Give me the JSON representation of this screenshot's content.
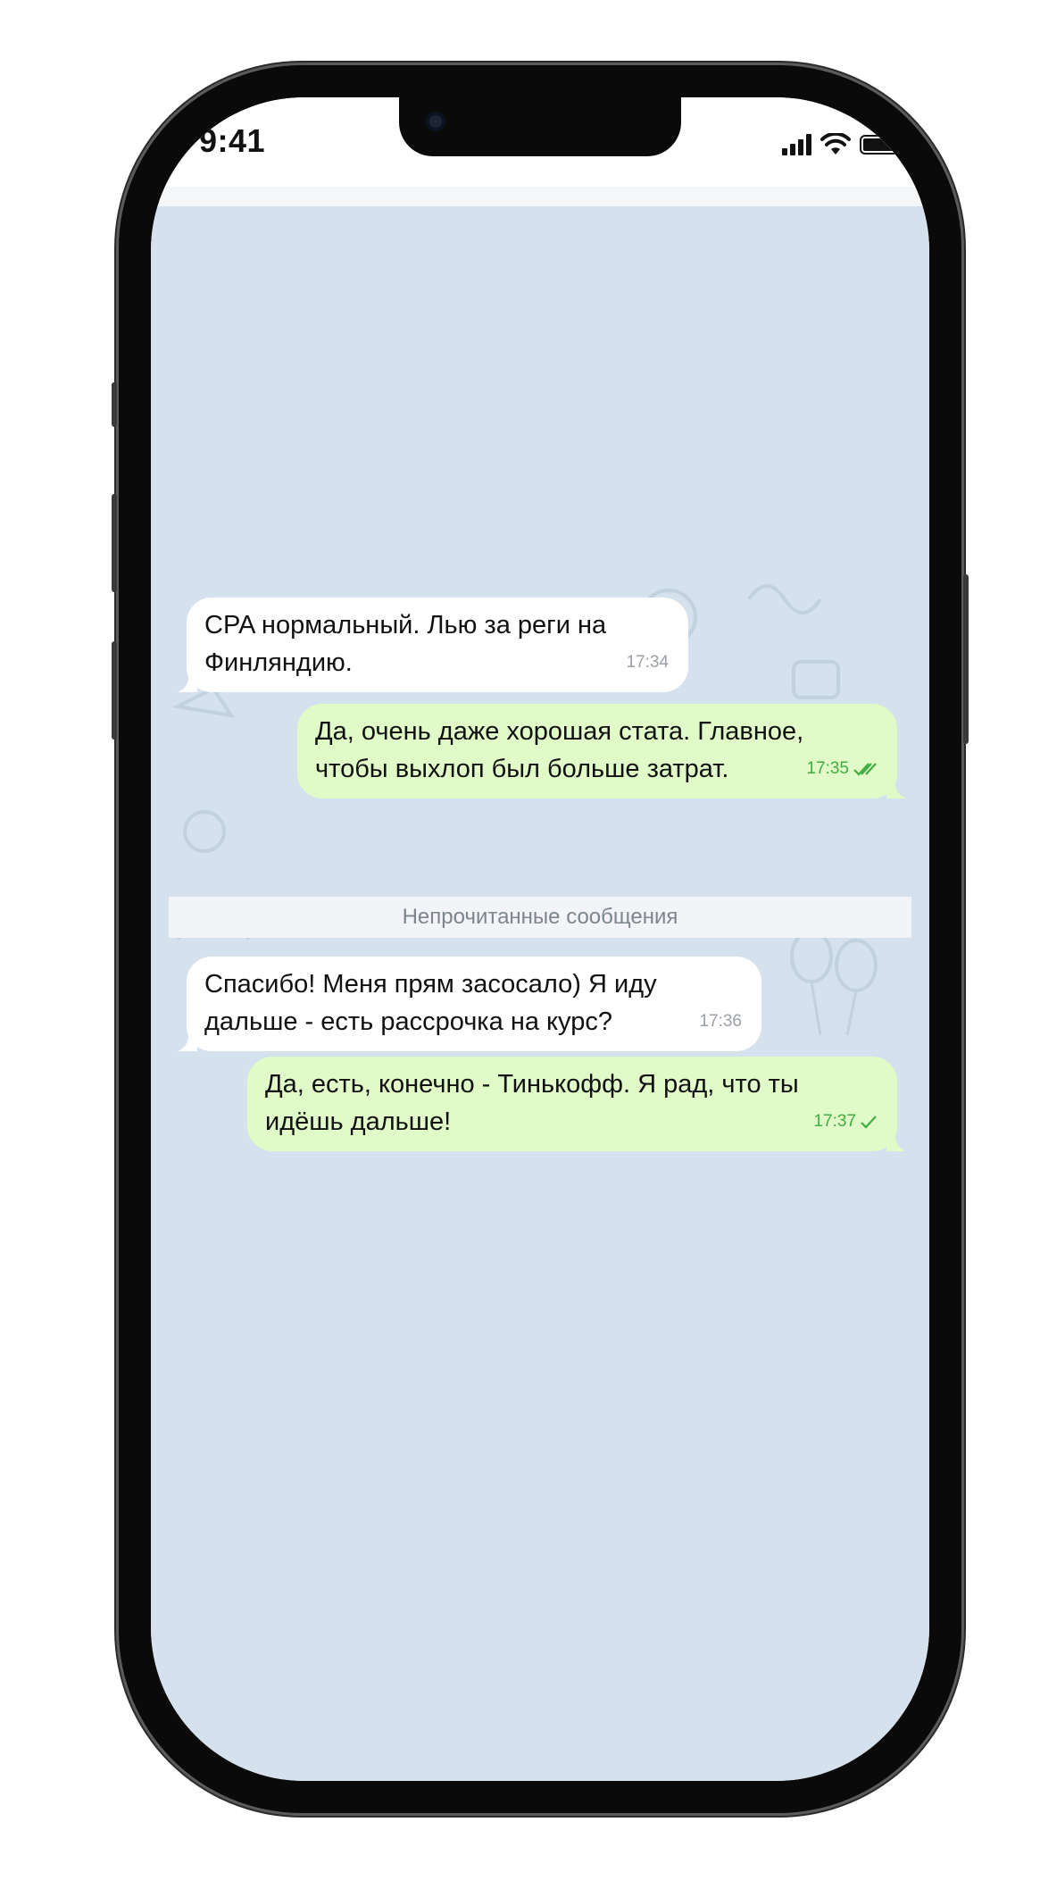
{
  "status_bar": {
    "time": "9:41"
  },
  "messages": [
    {
      "id": "m1",
      "direction": "incoming",
      "lines": [
        "CPA нормальный. Лью за реги на",
        "Финляндию."
      ],
      "time": "17:34"
    },
    {
      "id": "m2",
      "direction": "outgoing",
      "lines": [
        "Да, очень даже хорошая стата. Главное,",
        "чтобы выхлоп был больше затрат."
      ],
      "time": "17:35",
      "status": "read"
    },
    {
      "id": "m3",
      "direction": "incoming",
      "lines": [
        "Спасибо! Меня прям засосало) Я иду",
        "дальше - есть рассрочка на курс?"
      ],
      "time": "17:36"
    },
    {
      "id": "m4",
      "direction": "outgoing",
      "lines": [
        "Да, есть, конечно - Тинькофф. Я рад, что ты",
        "идёшь дальше!"
      ],
      "time": "17:37",
      "status": "sent"
    }
  ],
  "unread_divider": "Непрочитанные сообщения",
  "colors": {
    "chat_bg": "#d5e1ec",
    "incoming_bubble": "#ffffff",
    "outgoing_bubble": "#e0fbc8",
    "check_color": "#3fae3f"
  }
}
